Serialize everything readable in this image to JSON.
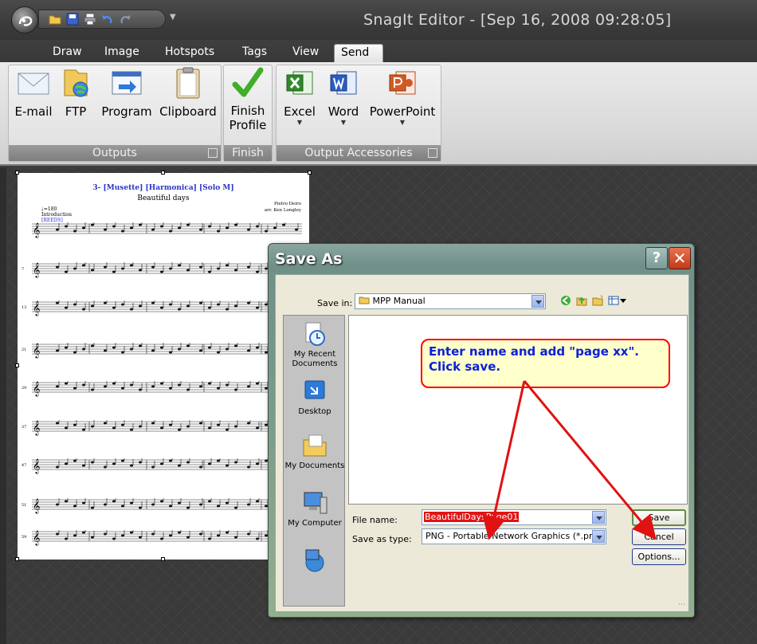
{
  "window": {
    "title": "SnagIt Editor - [Sep 16, 2008 09:28:05]"
  },
  "tabs": [
    "Draw",
    "Image",
    "Hotspots",
    "Tags",
    "View",
    "Send"
  ],
  "ribbon": {
    "outputs": {
      "label": "Outputs",
      "buttons": [
        "E-mail",
        "FTP",
        "Program",
        "Clipboard"
      ]
    },
    "finish": {
      "label": "Finish",
      "button_line1": "Finish",
      "button_line2": "Profile"
    },
    "accessories": {
      "label": "Output Accessories",
      "buttons": [
        "Excel",
        "Word",
        "PowerPoint"
      ]
    }
  },
  "sheet": {
    "title": "3- [Musette] [Harmonica] [Solo M]",
    "subtitle": "Beautiful days",
    "composer": "Pietro Deiro",
    "arranger": "arr. Ken Longley",
    "tempo": "♩=180",
    "intro": "Introduction",
    "reeds": "[REEDS]",
    "measure_numbers": [
      "7",
      "13",
      "21",
      "29",
      "37",
      "47",
      "51",
      "59"
    ]
  },
  "dialog": {
    "title": "Save As",
    "help": "?",
    "close": "✕",
    "save_in_label": "Save in:",
    "save_in_value": "MPP Manual",
    "places": [
      "My Recent Documents",
      "Desktop",
      "My Documents",
      "My Computer"
    ],
    "callout_line1": "Enter name and add \"page xx\".",
    "callout_line2": "Click save.",
    "file_name_label": "File name:",
    "file_name_value": "BeautifulDaysPage01",
    "save_as_type_label": "Save as type:",
    "save_as_type_value": "PNG - Portable Network Graphics (*.png)",
    "save_button": "Save",
    "cancel_button": "Cancel",
    "options_button": "Options..."
  },
  "colors": {
    "callout_text": "#0b21d6",
    "callout_border": "#ff0000",
    "arrow": "#e01212",
    "selection": "#e11414"
  }
}
